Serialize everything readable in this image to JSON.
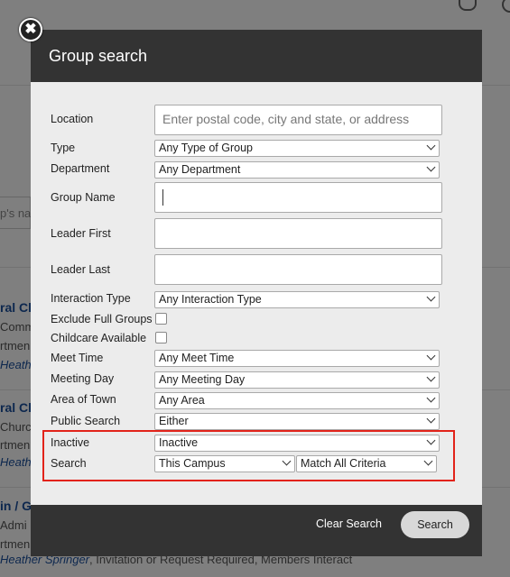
{
  "background": {
    "search_fragment": "p's na",
    "results": [
      {
        "title": "ral Ch",
        "line1": "Comm",
        "line2": "rtmen",
        "link": "Heath"
      },
      {
        "title": "ral Ch",
        "line1": "Churc",
        "line2": "rtmen",
        "link": "Heath"
      },
      {
        "title": "in / G",
        "line1": "Admi",
        "line2": "rtmen"
      }
    ],
    "footer_link": "Heather Springer",
    "footer_rest": ", Invitation or Request Required, Members Interact"
  },
  "modal": {
    "title": "Group search",
    "close_glyph": "✖",
    "fields": {
      "location": {
        "label": "Location",
        "placeholder": "Enter postal code, city and state, or address"
      },
      "type": {
        "label": "Type",
        "value": "Any Type of Group"
      },
      "department": {
        "label": "Department",
        "value": "Any Department"
      },
      "group_name": {
        "label": "Group Name",
        "value": ""
      },
      "leader_first": {
        "label": "Leader First",
        "value": ""
      },
      "leader_last": {
        "label": "Leader Last",
        "value": ""
      },
      "interaction_type": {
        "label": "Interaction Type",
        "value": "Any Interaction Type"
      },
      "exclude_full": {
        "label": "Exclude Full Groups",
        "checked": false
      },
      "childcare": {
        "label": "Childcare Available",
        "checked": false
      },
      "meet_time": {
        "label": "Meet Time",
        "value": "Any Meet Time"
      },
      "meeting_day": {
        "label": "Meeting Day",
        "value": "Any Meeting Day"
      },
      "area": {
        "label": "Area of Town",
        "value": "Any Area"
      },
      "public_search": {
        "label": "Public Search",
        "value": "Either"
      },
      "inactive": {
        "label": "Inactive",
        "value": "Inactive"
      },
      "search": {
        "label": "Search",
        "scope_value": "This Campus",
        "match_value": "Match All Criteria"
      }
    },
    "footer": {
      "clear_label": "Clear Search",
      "search_label": "Search"
    },
    "highlight_color": "#e2231a"
  }
}
